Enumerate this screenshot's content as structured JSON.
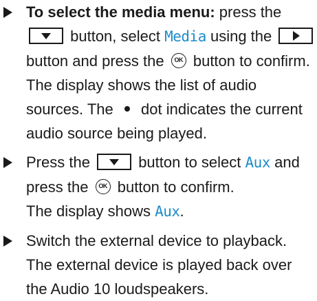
{
  "steps": [
    {
      "label": "To select the media menu:",
      "t1": "press the",
      "t2": "button, select",
      "media": "Media",
      "t3": "using the",
      "t4": "button and press the",
      "ok": "OK",
      "t5": "button to confirm.",
      "result1": "The display shows the list of audio sources. The",
      "result2": "dot indicates the current audio source being played."
    },
    {
      "t1": "Press the",
      "t2": "button to select",
      "aux": "Aux",
      "t3": "and press the",
      "ok": "OK",
      "t4": "button to confirm.",
      "result1": "The display shows",
      "result_aux": "Aux",
      "result_end": "."
    },
    {
      "t1": "Switch the external device to playback.",
      "result1": "The external device is played back over the Audio 10 loudspeakers."
    }
  ],
  "icons": {
    "bullet": "triangle-right-icon",
    "down_key": "down-arrow-button-icon",
    "right_key": "right-arrow-button-icon",
    "ok_key": "ok-button-icon",
    "dot": "bullet-dot-icon"
  },
  "colors": {
    "highlight": "#1d8bc9",
    "text": "#1a1a1a"
  }
}
